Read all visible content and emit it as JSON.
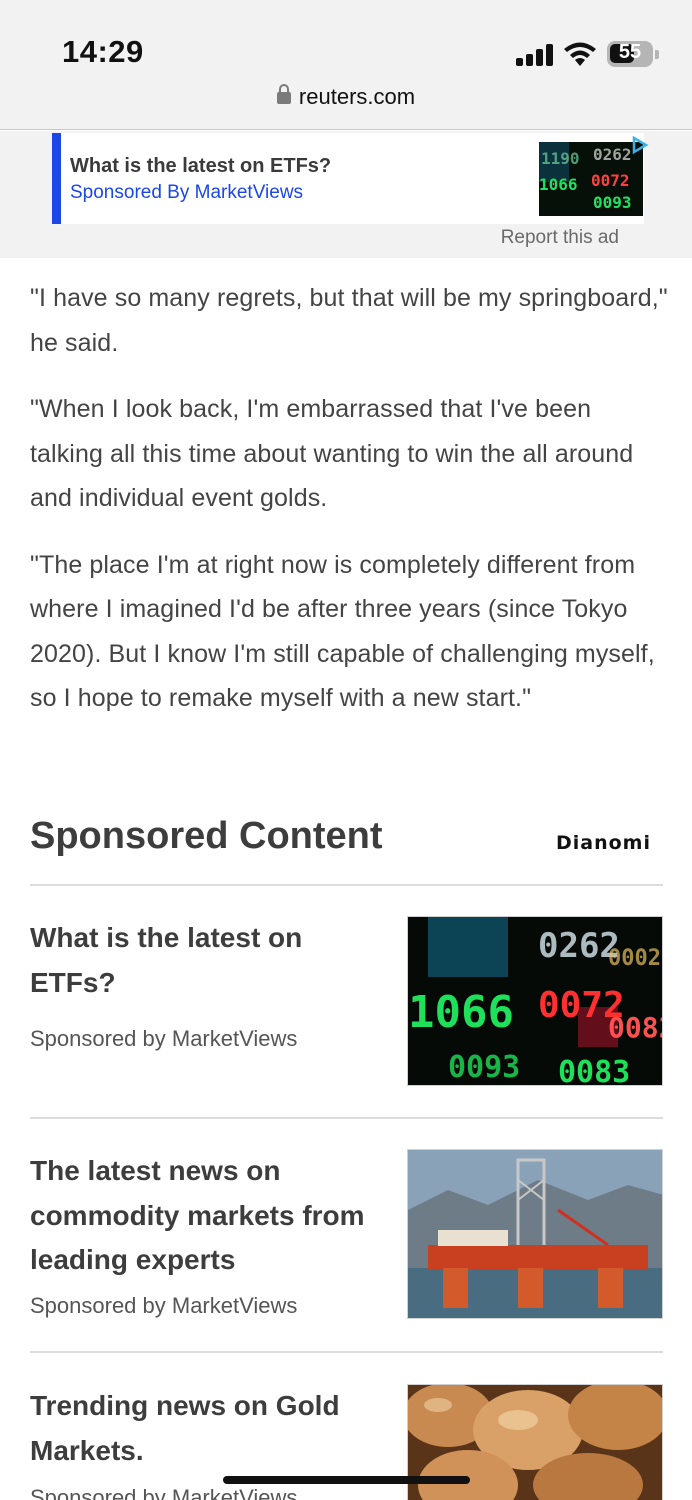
{
  "status_bar": {
    "time": "14:29",
    "battery_level": "55"
  },
  "url_bar": {
    "domain": "reuters.com",
    "lock_icon": "lock-icon"
  },
  "ad_banner": {
    "title": "What is the latest on ETFs?",
    "sponsor": "Sponsored By MarketViews",
    "report_label": "Report this ad",
    "accent_color": "#1a47e6",
    "image": "stock-ticker-thumbnail"
  },
  "article": {
    "paragraphs": [
      "\"I have so many regrets, but that will be my springboard,\" he said.",
      "\"When I look back, I'm embarrassed that I've been talking all this time about wanting to win the all around and individual event golds.",
      "\"The place I'm at right now is completely different from where I imagined I'd be after three years (since Tokyo 2020). But I know I'm still capable of challenging myself, so I hope to remake myself with a new start.\""
    ]
  },
  "sponsored": {
    "heading": "Sponsored Content",
    "provider_logo": "Dianomi",
    "items": [
      {
        "title": "What is the latest on ETFs?",
        "sponsor": "Sponsored by MarketViews",
        "image": "stock-ticker-image"
      },
      {
        "title": "The latest news on commodity markets from leading experts",
        "sponsor": "Sponsored by MarketViews",
        "image": "oil-rig-image"
      },
      {
        "title": "Trending news on Gold Markets.",
        "sponsor": "Sponsored by MarketViews",
        "image": "gold-nuggets-image"
      }
    ]
  }
}
